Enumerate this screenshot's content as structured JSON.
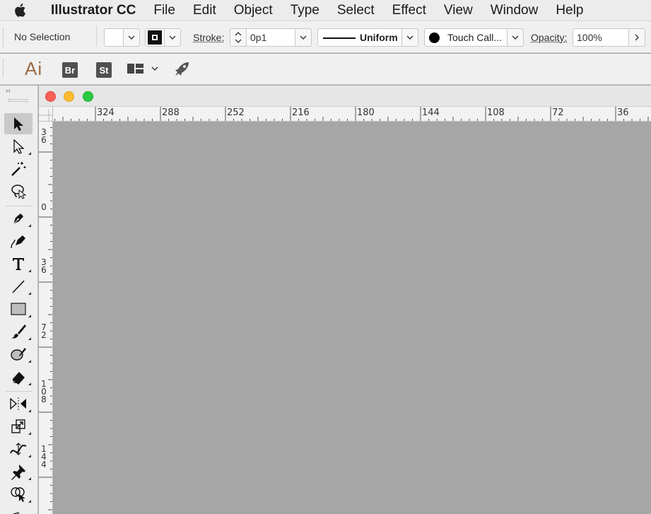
{
  "menubar": {
    "app_name": "Illustrator CC",
    "items": [
      "File",
      "Edit",
      "Object",
      "Type",
      "Select",
      "Effect",
      "View",
      "Window",
      "Help"
    ]
  },
  "controlbar": {
    "selection_label": "No Selection",
    "stroke_label": "Stroke:",
    "stroke_weight": "0p1",
    "stroke_profile": "Uniform",
    "brush": "Touch Call...",
    "opacity_label": "Opacity:",
    "opacity_value": "100%"
  },
  "appbar": {
    "logo": "Ai",
    "bridge": "Br",
    "stock": "St"
  },
  "tools": [
    "selection-tool",
    "direct-selection-tool",
    "magic-wand-tool",
    "lasso-tool",
    "pen-tool",
    "curvature-tool",
    "type-tool",
    "line-segment-tool",
    "rectangle-tool",
    "paintbrush-tool",
    "shaper-tool",
    "eraser-tool",
    "rotate-tool",
    "scale-tool",
    "width-tool",
    "puppet-warp-tool",
    "shape-builder-tool"
  ],
  "rulers": {
    "horizontal": [
      "324",
      "288",
      "252",
      "216",
      "180",
      "144",
      "108",
      "72",
      "36"
    ],
    "vertical": [
      "36",
      "0",
      "36",
      "72",
      "108",
      "144"
    ]
  },
  "colors": {
    "canvas": "#a6a6a6",
    "panel": "#eeeeee",
    "close": "#fc5f57",
    "minimize": "#fdbc2e",
    "zoom": "#29c940"
  }
}
